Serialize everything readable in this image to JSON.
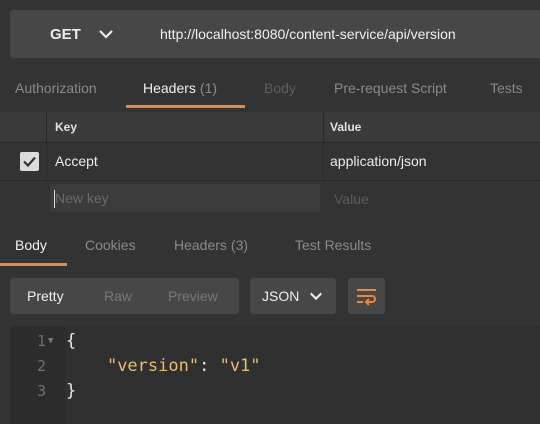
{
  "request": {
    "method": "GET",
    "url": "http://localhost:8080/content-service/api/version"
  },
  "request_tabs": [
    {
      "label": "Authorization",
      "count": "",
      "state": "normal"
    },
    {
      "label": "Headers",
      "count": "(1)",
      "state": "active"
    },
    {
      "label": "Body",
      "count": "",
      "state": "disabled"
    },
    {
      "label": "Pre-request Script",
      "count": "",
      "state": "normal"
    },
    {
      "label": "Tests",
      "count": "",
      "state": "normal"
    }
  ],
  "headers_table": {
    "key_header": "Key",
    "value_header": "Value",
    "rows": [
      {
        "checked": true,
        "key": "Accept",
        "value": "application/json"
      }
    ],
    "new_key_placeholder": "New key",
    "new_value_placeholder": "Value"
  },
  "response_tabs": [
    {
      "label": "Body",
      "count": "",
      "state": "active"
    },
    {
      "label": "Cookies",
      "count": "",
      "state": "normal"
    },
    {
      "label": "Headers",
      "count": "(3)",
      "state": "normal"
    },
    {
      "label": "Test Results",
      "count": "",
      "state": "normal"
    }
  ],
  "response_toolbar": {
    "view_modes": [
      "Pretty",
      "Raw",
      "Preview"
    ],
    "active_view": "Pretty",
    "format": "JSON",
    "wrap_icon": "wrap-lines-icon"
  },
  "response_body": {
    "line_numbers": [
      "1",
      "2",
      "3"
    ],
    "open_brace": "{",
    "key": "\"version\"",
    "colon": ":",
    "value": "\"v1\"",
    "close_brace": "}"
  },
  "colors": {
    "accent": "#e8883a",
    "string": "#e9bd6c",
    "background": "#333333",
    "control": "#474747"
  }
}
